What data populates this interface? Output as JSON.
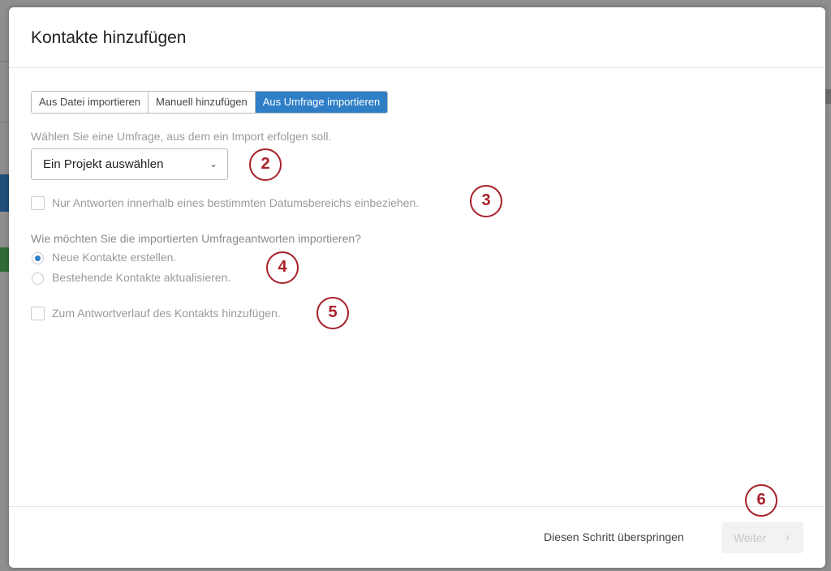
{
  "modal": {
    "title": "Kontakte hinzufügen"
  },
  "tabs": [
    {
      "label": "Aus Datei importieren",
      "active": false
    },
    {
      "label": "Manuell hinzufügen",
      "active": false
    },
    {
      "label": "Aus Umfrage importieren",
      "active": true
    }
  ],
  "survey": {
    "label": "Wählen Sie eine Umfrage, aus dem ein Import erfolgen soll.",
    "select_value": "Ein Projekt auswählen"
  },
  "date_range": {
    "label": "Nur Antworten innerhalb eines bestimmten Datumsbereichs einbeziehen.",
    "checked": false
  },
  "import_mode": {
    "question": "Wie möchten Sie die importierten Umfrageantworten importieren?",
    "options": [
      {
        "label": "Neue Kontakte erstellen.",
        "selected": true
      },
      {
        "label": "Bestehende Kontakte aktualisieren.",
        "selected": false
      }
    ]
  },
  "history": {
    "label": "Zum Antwortverlauf des Kontakts hinzufügen.",
    "checked": false
  },
  "footer": {
    "skip_label": "Diesen Schritt überspringen",
    "next_label": "Weiter"
  },
  "annotations": [
    "2",
    "3",
    "4",
    "5",
    "6"
  ],
  "colors": {
    "accent": "#2f7fc7",
    "annotation": "#a8202a"
  }
}
